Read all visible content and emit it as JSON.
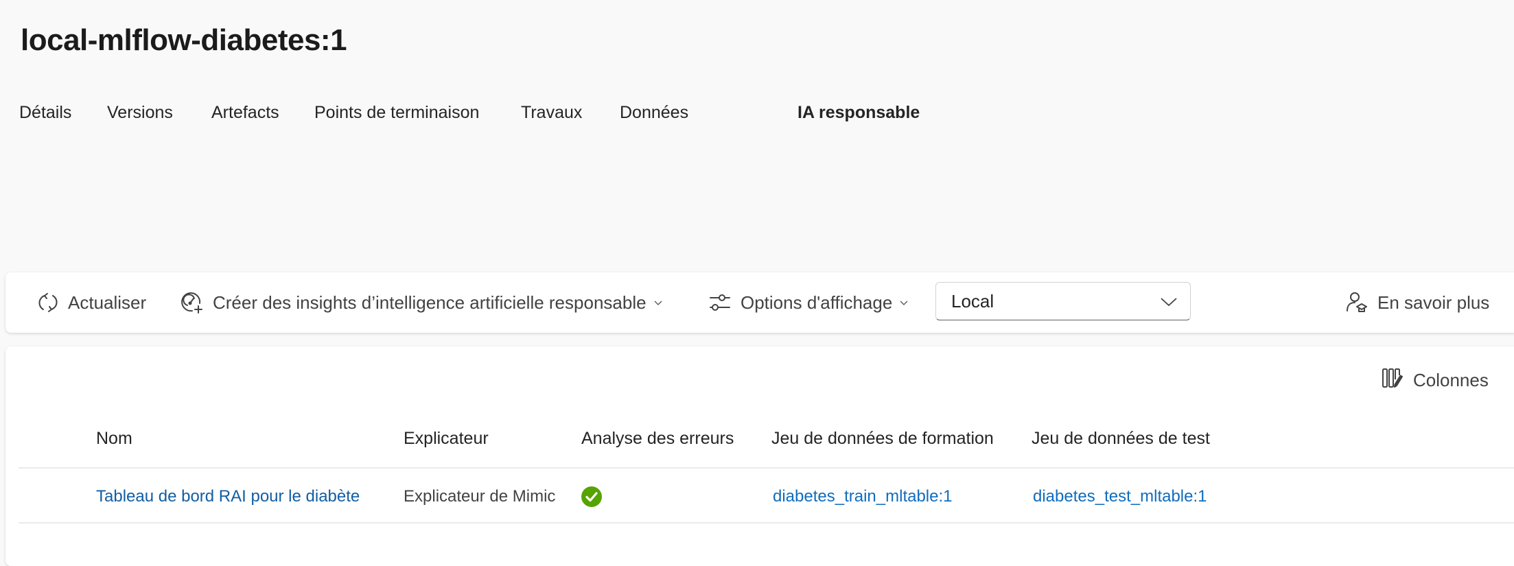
{
  "header": {
    "title": "local-mlflow-diabetes:1"
  },
  "tabs": [
    {
      "label": "Détails",
      "selected": false
    },
    {
      "label": "Versions",
      "selected": false
    },
    {
      "label": "Artefacts",
      "selected": false
    },
    {
      "label": "Points de terminaison",
      "selected": false
    },
    {
      "label": "Travaux",
      "selected": false
    },
    {
      "label": "Données",
      "selected": false
    },
    {
      "label": "IA responsable",
      "selected": true
    }
  ],
  "toolbar": {
    "refresh_label": "Actualiser",
    "refresh_icon": "arrow-sync-icon",
    "create_label": "Créer des insights d’intelligence artificielle responsable",
    "create_icon": "gauge-add-icon",
    "view_options_label": "Options d'affichage",
    "view_options_icon": "options-sliders-icon",
    "scope_dropdown": {
      "selected": "Local"
    },
    "learn_more_label": "En savoir plus",
    "learn_more_icon": "person-learning-icon"
  },
  "table": {
    "columns_button_label": "Colonnes",
    "columns_icon": "column-edit-icon",
    "headers": [
      "Nom",
      "Explicateur",
      "Analyse des erreurs",
      "Jeu de données de formation",
      "Jeu de données de test"
    ],
    "rows": [
      {
        "name": "Tableau de bord RAI pour le diabète",
        "explainer": "Explicateur de Mimic",
        "error_analysis": "success",
        "train_dataset": "diabetes_train_mltable:1",
        "test_dataset": "diabetes_test_mltable:1"
      }
    ]
  },
  "colors": {
    "link": "#115ea3",
    "success": "#57a300",
    "background": "#f9f9f9",
    "card": "#ffffff"
  }
}
